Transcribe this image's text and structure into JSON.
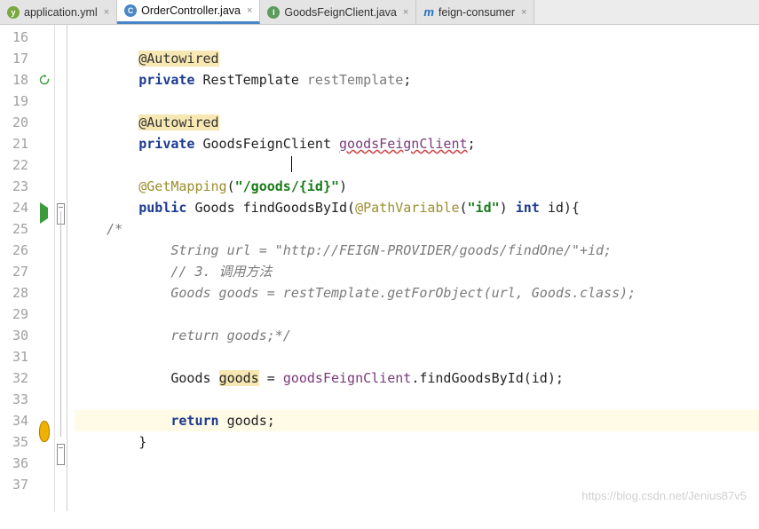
{
  "tabs": [
    {
      "icon": "yml",
      "label": "application.yml",
      "active": false
    },
    {
      "icon": "c",
      "label": "OrderController.java",
      "active": true
    },
    {
      "icon": "i",
      "label": "GoodsFeignClient.java",
      "active": false
    },
    {
      "icon": "m",
      "label": "feign-consumer",
      "active": false
    }
  ],
  "line_start": 16,
  "line_end": 38,
  "gutter_markers": {
    "18": "recycle",
    "24": "run",
    "34": "bulb"
  },
  "fold_markers": {
    "24": "minus",
    "35": "minus"
  },
  "fold_line": {
    "from": 24,
    "to": 35
  },
  "caret_line": 34,
  "code": {
    "l16": "",
    "l17": {
      "indent": "        ",
      "ann": "@Autowired"
    },
    "l18": {
      "indent": "        ",
      "kw": "private",
      "type": "RestTemplate",
      "field": "restTemplate",
      "end": ";"
    },
    "l19": "",
    "l20": {
      "indent": "        ",
      "ann": "@Autowired"
    },
    "l21": {
      "indent": "        ",
      "kw": "private",
      "type": "GoodsFeignClient",
      "field": "goodsFeignClient",
      "end": ";"
    },
    "l22": "",
    "l23": {
      "indent": "        ",
      "ann": "@GetMapping",
      "paren_open": "(",
      "str": "\"/goods/{id}\"",
      "paren_close": ")"
    },
    "l24": {
      "indent": "        ",
      "kw": "public",
      "type": "Goods",
      "name": "findGoodsById",
      "paren_open": "(",
      "ann2": "@PathVariable",
      "p2o": "(",
      "str": "\"id\"",
      "p2c": ")",
      "kw2": "int",
      "param": "id",
      "paren_close": ")",
      "brace": "{"
    },
    "l25": {
      "indent": "    ",
      "cmt_open": "/*"
    },
    "l26": {
      "indent": "            ",
      "cmt": "String url = \"http://FEIGN-PROVIDER/goods/findOne/\"+id;"
    },
    "l27": {
      "indent": "            ",
      "cmt": "// 3. 调用方法"
    },
    "l28": {
      "indent": "            ",
      "cmt": "Goods goods = restTemplate.getForObject(url, Goods.class);"
    },
    "l29": "",
    "l30": {
      "indent": "            ",
      "cmt": "return goods;*/"
    },
    "l31": "",
    "l32": {
      "indent": "            ",
      "type": "Goods",
      "var": "goods",
      "eq": " = ",
      "ref": "goodsFeignClient",
      "dot": ".",
      "call": "findGoodsById",
      "paren_open": "(",
      "arg": "id",
      "paren_close": ")",
      "end": ";"
    },
    "l33": "",
    "l34": {
      "indent": "            ",
      "kw": "return",
      "sp": " ",
      "var": "goods",
      "end": ";"
    },
    "l35": {
      "indent": "        ",
      "brace": "}"
    },
    "l36": "",
    "l37": ""
  },
  "watermark": "https://blog.csdn.net/Jenius87v5"
}
